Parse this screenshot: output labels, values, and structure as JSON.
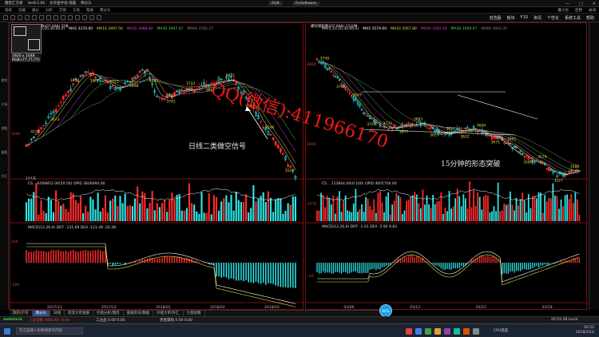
{
  "titlebar": {
    "app_name": "鑫智汇交易",
    "account": "Ver8.5.66",
    "window_labels": [
      "文华金手指·电脑",
      "两分头"
    ],
    "wm_buttons": [
      "RGB",
      "FinSoftware"
    ],
    "controls": [
      "—",
      "□",
      "✕"
    ]
  },
  "menubar": {
    "items": [
      "系统",
      "功能",
      "报价",
      "分析",
      "交易",
      "工具",
      "帮助",
      "两分头"
    ],
    "right_items": [
      "最小化",
      "还原",
      "关闭"
    ]
  },
  "toolbar": {
    "right_links": [
      "自选股",
      "板块",
      "F10",
      "资讯",
      "个性化",
      "系统工具",
      "帮助"
    ]
  },
  "left_strip": [
    "期货",
    "沪深",
    "港股",
    "美股",
    "外汇"
  ],
  "thumb_label": "1920 x 1048\nRGB:(77,77,77)",
  "left_chart": {
    "title": "螺纹钢指数(DT 888) 日线",
    "ma_labels": [
      {
        "text": "MA(5,10,20,30,60,0)",
        "color": "#dddddd"
      },
      {
        "text": "MA5 3370.00",
        "color": "#ffffff"
      },
      {
        "text": "MA10 3497.50",
        "color": "#e0e040"
      },
      {
        "text": "MA20 3688.80",
        "color": "#e040e0"
      },
      {
        "text": "MA30 3697.47",
        "color": "#40e040"
      },
      {
        "text": "MA60 3782.27",
        "color": "#888888"
      }
    ],
    "price_axis": [
      "3500"
    ],
    "price_notes": [
      "4138",
      "3673",
      "3858",
      "3981",
      "4021",
      "3998",
      "3795",
      "3741",
      "3722",
      "3812",
      "3825",
      "3591",
      "3246",
      "3525"
    ],
    "date_axis": [
      "2017/11",
      "2017/12",
      "2018/01",
      "2018/02",
      "2018/03"
    ],
    "volume_header": "CS... 6569852.00(50:50)  OPID 3626694.00",
    "volume_count_label": "104天",
    "macd_header": "MACD(12,26,9)  DIFF -131.69  DEA -121.49  -20.38",
    "macd_axis": [
      "100",
      "-100"
    ],
    "annotation": "日线二类做空信号"
  },
  "right_chart": {
    "title": "螺纹钢指数(DT 888) 15分钟",
    "ma_labels": [
      {
        "text": "MA(5,10,20,30,60,0)",
        "color": "#dddddd"
      },
      {
        "text": "MA5 3579.60",
        "color": "#ffffff"
      },
      {
        "text": "MA10 3567.80",
        "color": "#e0e040"
      },
      {
        "text": "MA20 3562.20",
        "color": "#e040e0"
      },
      {
        "text": "MA30 3569.07",
        "color": "#40e040"
      },
      {
        "text": "MA60 3603.35",
        "color": "#888888"
      }
    ],
    "price_axis": [
      "3800",
      "3600"
    ],
    "price_notes": [
      "3758",
      "3747",
      "3697",
      "3720",
      "3733",
      "3677",
      "3653",
      "3637",
      "3627",
      "3622",
      "3694",
      "3671",
      "3661",
      "3580",
      "3579",
      "3527",
      "3580"
    ],
    "date_axis": [
      "03/09",
      "03/13",
      "03/15",
      "03/19"
    ],
    "volume_header": "CS... 113844.00(0:100)  OPID 4001704.00",
    "volume_axis": [
      "4775"
    ],
    "macd_header": "MACD(12,26,9)  DIFF -1.01  DEA -5.92  9.83",
    "macd_axis": [
      "-20"
    ],
    "annotation": "15分钟的形态突破"
  },
  "watermark": "QQ(微信):411966170",
  "bottom_tabs": [
    "期货/沪深",
    "两分头",
    "日线",
    "周及大单金额",
    "外盘分析/期货",
    "金融资讯/数据",
    "外盘大单/外汇",
    "大盘指数"
  ],
  "active_tab": "两分头",
  "float_button": "66%",
  "statusbar": {
    "left": "上证指数 2681.64 -4.94",
    "middle": "工业品 0.00 0.00",
    "right": "贵金属指 0.00 0.00",
    "clock": "20:52:38 Local"
  },
  "taskbar": {
    "search_placeholder": "在这里输入你要搜索的内容",
    "tray_time": "20:52",
    "tray_date": "2018/3/14",
    "cpu_label": "CPU温度"
  },
  "colors": {
    "up": "#2ee6e6",
    "down": "#ff2a2a",
    "frame": "#7a1010",
    "watermark": "#ff1a1a"
  }
}
